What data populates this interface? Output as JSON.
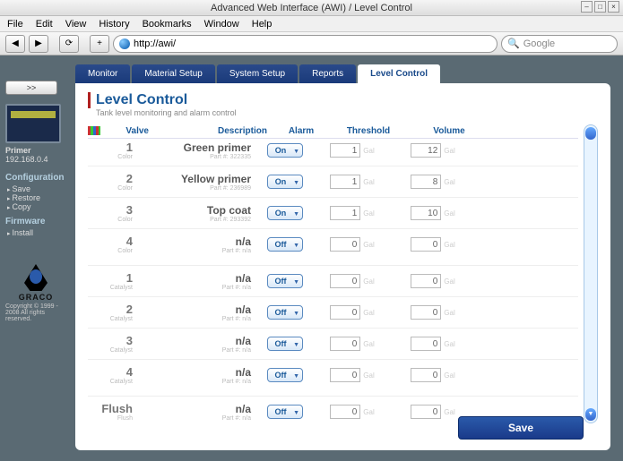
{
  "window": {
    "title": "Advanced Web Interface (AWI) / Level Control",
    "menus": [
      "File",
      "Edit",
      "View",
      "History",
      "Bookmarks",
      "Window",
      "Help"
    ],
    "url": "http://awi/",
    "search_placeholder": "Google"
  },
  "sidebar": {
    "dropdown": ">>",
    "device_name": "Primer",
    "device_ip": "192.168.0.4",
    "config_head": "Configuration",
    "config_items": [
      "Save",
      "Restore",
      "Copy"
    ],
    "firmware_head": "Firmware",
    "firmware_items": [
      "Install"
    ],
    "brand": "GRACO",
    "copyright": "Copyright © 1999 - 2008\nAll rights reserved."
  },
  "tabs": [
    "Monitor",
    "Material Setup",
    "System Setup",
    "Reports",
    "Level Control"
  ],
  "active_tab": 4,
  "page": {
    "title": "Level Control",
    "subtitle": "Tank level monitoring and alarm control",
    "headers": {
      "valve": "Valve",
      "desc": "Description",
      "alarm": "Alarm",
      "threshold": "Threshold",
      "volume": "Volume"
    },
    "unit": "Gal",
    "save": "Save"
  },
  "rows": [
    {
      "valve": "1",
      "type": "Color",
      "desc": "Green primer",
      "part": "Part #: 322335",
      "alarm": "On",
      "threshold": 1,
      "volume": 12
    },
    {
      "valve": "2",
      "type": "Color",
      "desc": "Yellow primer",
      "part": "Part #: 236989",
      "alarm": "On",
      "threshold": 1,
      "volume": 8
    },
    {
      "valve": "3",
      "type": "Color",
      "desc": "Top coat",
      "part": "Part #: 293392",
      "alarm": "On",
      "threshold": 1,
      "volume": 10
    },
    {
      "valve": "4",
      "type": "Color",
      "desc": "n/a",
      "part": "Part #: n/a",
      "alarm": "Off",
      "threshold": 0,
      "volume": 0
    }
  ],
  "rows2": [
    {
      "valve": "1",
      "type": "Catalyst",
      "desc": "n/a",
      "part": "Part #: n/a",
      "alarm": "Off",
      "threshold": 0,
      "volume": 0
    },
    {
      "valve": "2",
      "type": "Catalyst",
      "desc": "n/a",
      "part": "Part #: n/a",
      "alarm": "Off",
      "threshold": 0,
      "volume": 0
    },
    {
      "valve": "3",
      "type": "Catalyst",
      "desc": "n/a",
      "part": "Part #: n/a",
      "alarm": "Off",
      "threshold": 0,
      "volume": 0
    },
    {
      "valve": "4",
      "type": "Catalyst",
      "desc": "n/a",
      "part": "Part #: n/a",
      "alarm": "Off",
      "threshold": 0,
      "volume": 0
    }
  ],
  "rows3": [
    {
      "valve": "Flush",
      "type": "Flush",
      "desc": "n/a",
      "part": "Part #: n/a",
      "alarm": "Off",
      "threshold": 0,
      "volume": 0
    }
  ]
}
